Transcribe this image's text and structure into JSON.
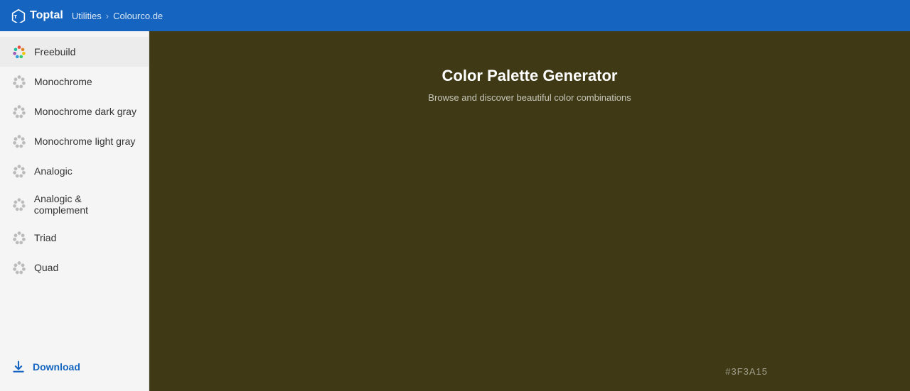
{
  "header": {
    "logo_text": "Toptal",
    "breadcrumb": [
      {
        "label": "Utilities",
        "href": "#"
      },
      {
        "label": "Colourco.de",
        "href": "#"
      }
    ]
  },
  "sidebar": {
    "items": [
      {
        "id": "freebuild",
        "label": "Freebuild",
        "active": true,
        "icon": "freebuild"
      },
      {
        "id": "monochrome",
        "label": "Monochrome",
        "active": false,
        "icon": "mono"
      },
      {
        "id": "monochrome-dark",
        "label": "Monochrome dark gray",
        "active": false,
        "icon": "mono"
      },
      {
        "id": "monochrome-light",
        "label": "Monochrome light gray",
        "active": false,
        "icon": "mono"
      },
      {
        "id": "analogic",
        "label": "Analogic",
        "active": false,
        "icon": "mono"
      },
      {
        "id": "analogic-complement",
        "label": "Analogic & complement",
        "active": false,
        "icon": "mono"
      },
      {
        "id": "triad",
        "label": "Triad",
        "active": false,
        "icon": "mono"
      },
      {
        "id": "quad",
        "label": "Quad",
        "active": false,
        "icon": "mono"
      }
    ],
    "download_label": "Download"
  },
  "content": {
    "title": "Color Palette Generator",
    "subtitle": "Browse and discover beautiful color combinations",
    "background_color": "#3F3A15",
    "color_code": "#3F3A15"
  }
}
